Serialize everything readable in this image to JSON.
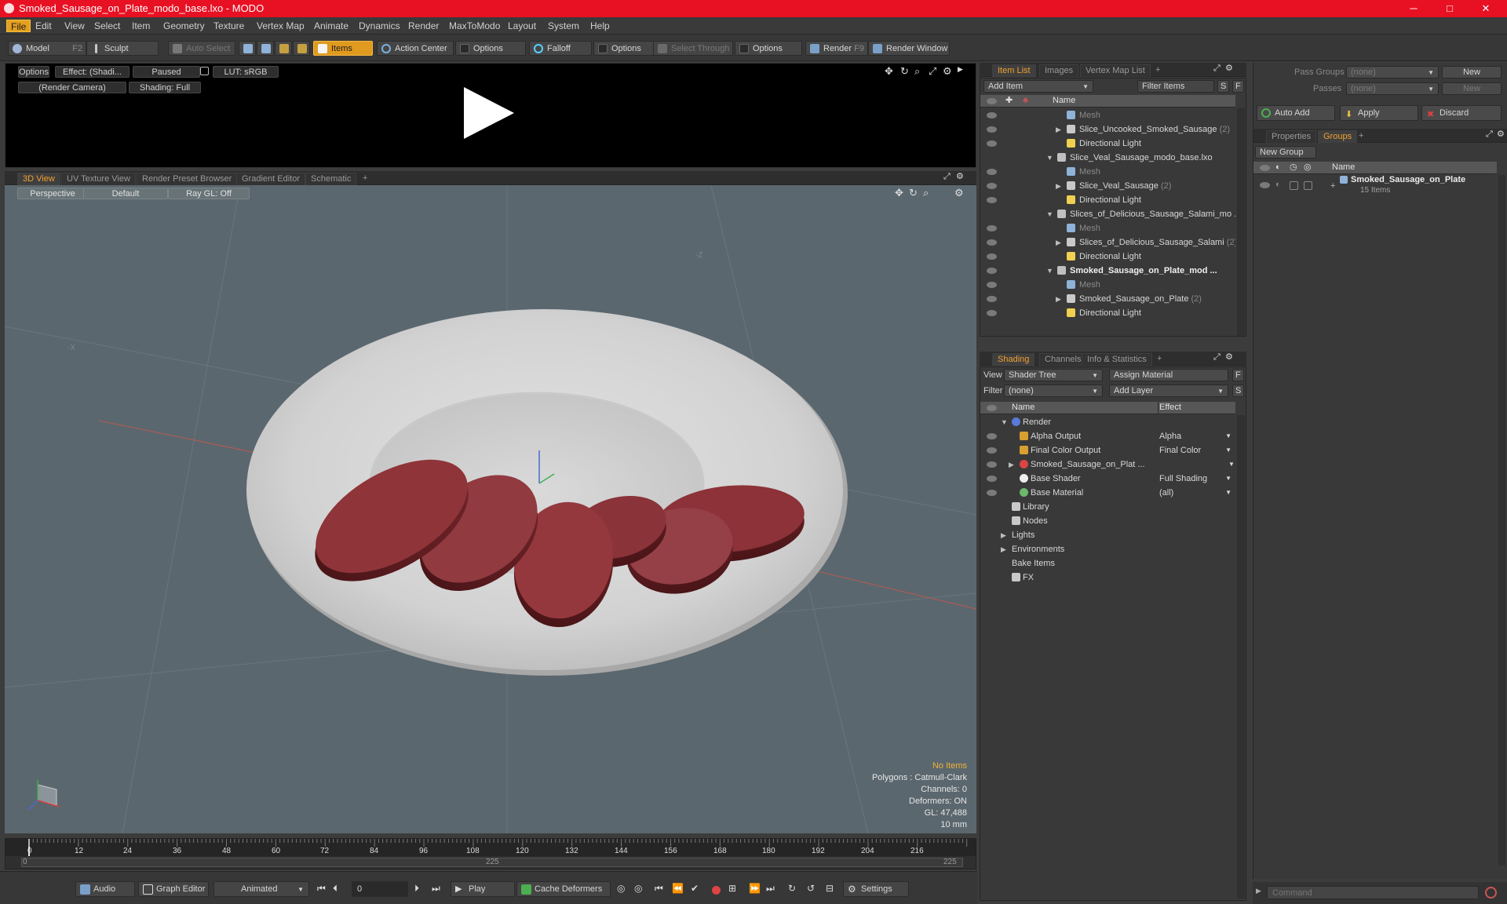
{
  "window": {
    "title": "Smoked_Sausage_on_Plate_modo_base.lxo - MODO",
    "minimize": "─",
    "maximize": "□",
    "close": "✕"
  },
  "menu": [
    "File",
    "Edit",
    "View",
    "Select",
    "Item",
    "Geometry",
    "Texture",
    "Vertex Map",
    "Animate",
    "Dynamics",
    "Render",
    "MaxToModo",
    "Layout",
    "System",
    "Help"
  ],
  "toolbar": {
    "model": "Model",
    "model_key": "F2",
    "sculpt": "Sculpt",
    "auto_select": "Auto Select",
    "items": "Items",
    "action_center": "Action Center",
    "options1": "Options",
    "falloff": "Falloff",
    "options2": "Options",
    "select_through": "Select Through",
    "options3": "Options",
    "render": "Render",
    "render_key": "F9",
    "render_window": "Render Window"
  },
  "preview": {
    "options": "Options",
    "effect": "Effect: (Shadi...",
    "paused": "Paused",
    "lut": "LUT: sRGB",
    "camera": "(Render Camera)",
    "shading": "Shading: Full"
  },
  "view_tabs": [
    "3D View",
    "UV Texture View",
    "Render Preset Browser",
    "Gradient Editor",
    "Schematic",
    "+"
  ],
  "viewport": {
    "perspective": "Perspective",
    "default": "Default",
    "raygl": "Ray GL: Off",
    "axis_neg_z": "-Z",
    "axis_neg_x": "-X",
    "stats": {
      "items": "No Items",
      "polygons": "Polygons : Catmull-Clark",
      "channels": "Channels: 0",
      "deformers": "Deformers: ON",
      "gl": "GL: 47,488",
      "unit": "10 mm"
    }
  },
  "timeline": {
    "ticks": [
      "0",
      "12",
      "24",
      "36",
      "48",
      "60",
      "72",
      "84",
      "96",
      "108",
      "120",
      "132",
      "144",
      "156",
      "168",
      "180",
      "192",
      "204",
      "216"
    ],
    "start": "0",
    "mid": "225",
    "end": "225"
  },
  "bottombar": {
    "audio": "Audio",
    "graph_editor": "Graph Editor",
    "animated": "Animated",
    "frame": "0",
    "play": "Play",
    "cache": "Cache Deformers",
    "settings": "Settings"
  },
  "itemlist": {
    "tabs": [
      "Item List",
      "Images",
      "Vertex Map List",
      "+"
    ],
    "add_item": "Add Item",
    "filter_items": "Filter Items",
    "s": "S",
    "f": "F",
    "col_name": "Name",
    "rows": [
      {
        "label": "Mesh",
        "count": "",
        "level": 2,
        "kind": "mesh",
        "arrow": ""
      },
      {
        "label": "Slice_Uncooked_Smoked_Sausage",
        "count": "(2)",
        "level": 2,
        "kind": "group",
        "arrow": "▶"
      },
      {
        "label": "Directional Light",
        "count": "",
        "level": 2,
        "kind": "light",
        "arrow": ""
      },
      {
        "label": "Slice_Veal_Sausage_modo_base.lxo",
        "count": "",
        "level": 1,
        "kind": "scene",
        "arrow": "▼"
      },
      {
        "label": "Mesh",
        "count": "",
        "level": 2,
        "kind": "mesh",
        "arrow": ""
      },
      {
        "label": "Slice_Veal_Sausage",
        "count": "(2)",
        "level": 2,
        "kind": "group",
        "arrow": "▶"
      },
      {
        "label": "Directional Light",
        "count": "",
        "level": 2,
        "kind": "light",
        "arrow": ""
      },
      {
        "label": "Slices_of_Delicious_Sausage_Salami_mo ...",
        "count": "",
        "level": 1,
        "kind": "scene",
        "arrow": "▼"
      },
      {
        "label": "Mesh",
        "count": "",
        "level": 2,
        "kind": "mesh",
        "arrow": ""
      },
      {
        "label": "Slices_of_Delicious_Sausage_Salami",
        "count": "(2)",
        "level": 2,
        "kind": "group",
        "arrow": "▶"
      },
      {
        "label": "Directional Light",
        "count": "",
        "level": 2,
        "kind": "light",
        "arrow": ""
      },
      {
        "label": "Smoked_Sausage_on_Plate_mod ...",
        "count": "",
        "level": 1,
        "kind": "scene",
        "arrow": "▼",
        "bold": true
      },
      {
        "label": "Mesh",
        "count": "",
        "level": 2,
        "kind": "mesh",
        "arrow": ""
      },
      {
        "label": "Smoked_Sausage_on_Plate",
        "count": "(2)",
        "level": 2,
        "kind": "group",
        "arrow": "▶"
      },
      {
        "label": "Directional Light",
        "count": "",
        "level": 2,
        "kind": "light",
        "arrow": ""
      }
    ]
  },
  "shading": {
    "tabs": [
      "Shading",
      "Channels",
      "Info & Statistics",
      "+"
    ],
    "view_label": "View",
    "view_value": "Shader Tree",
    "assign_material": "Assign Material",
    "filter_label": "Filter",
    "filter_value": "(none)",
    "add_layer": "Add Layer",
    "f": "F",
    "s": "S",
    "col_name": "Name",
    "col_effect": "Effect",
    "rows": [
      {
        "label": "Render",
        "effect": "",
        "level": 0,
        "arrow": "▼",
        "icon": "render",
        "eye": false
      },
      {
        "label": "Alpha Output",
        "effect": "Alpha",
        "level": 1,
        "arrow": "",
        "icon": "output",
        "eye": true
      },
      {
        "label": "Final Color Output",
        "effect": "Final Color",
        "level": 1,
        "arrow": "",
        "icon": "output",
        "eye": true
      },
      {
        "label": "Smoked_Sausage_on_Plat ...",
        "effect": "",
        "level": 1,
        "arrow": "▶",
        "icon": "material",
        "eye": true
      },
      {
        "label": "Base Shader",
        "effect": "Full Shading",
        "level": 1,
        "arrow": "",
        "icon": "shader",
        "eye": true
      },
      {
        "label": "Base Material",
        "effect": "(all)",
        "level": 1,
        "arrow": "",
        "icon": "basemat",
        "eye": true
      },
      {
        "label": "Library",
        "effect": "",
        "level": 0,
        "arrow": "",
        "icon": "folder",
        "eye": false
      },
      {
        "label": "Nodes",
        "effect": "",
        "level": 0,
        "arrow": "",
        "icon": "folder",
        "eye": false
      },
      {
        "label": "Lights",
        "effect": "",
        "level": -1,
        "arrow": "▶",
        "icon": "",
        "eye": false
      },
      {
        "label": "Environments",
        "effect": "",
        "level": -1,
        "arrow": "▶",
        "icon": "",
        "eye": false
      },
      {
        "label": "Bake Items",
        "effect": "",
        "level": -1,
        "arrow": "",
        "icon": "",
        "eye": false
      },
      {
        "label": "FX",
        "effect": "",
        "level": 0,
        "arrow": "",
        "icon": "fx",
        "eye": false
      }
    ]
  },
  "groups": {
    "pass_groups_label": "Pass Groups",
    "pass_groups_value": "(none)",
    "new1": "New",
    "passes_label": "Passes",
    "passes_value": "(none)",
    "new2": "New",
    "auto_add": "Auto Add",
    "apply": "Apply",
    "discard": "Discard",
    "tabs": [
      "Properties",
      "Groups",
      "+"
    ],
    "new_group": "New Group",
    "col_name": "Name",
    "item_name": "Smoked_Sausage_on_Plate",
    "item_count": "15 Items"
  },
  "command": {
    "placeholder": "Command"
  },
  "colors": {
    "accent": "#f0a030",
    "titlebar": "#e81123",
    "viewport": "#5b676e",
    "sausage": "#8c3238"
  }
}
